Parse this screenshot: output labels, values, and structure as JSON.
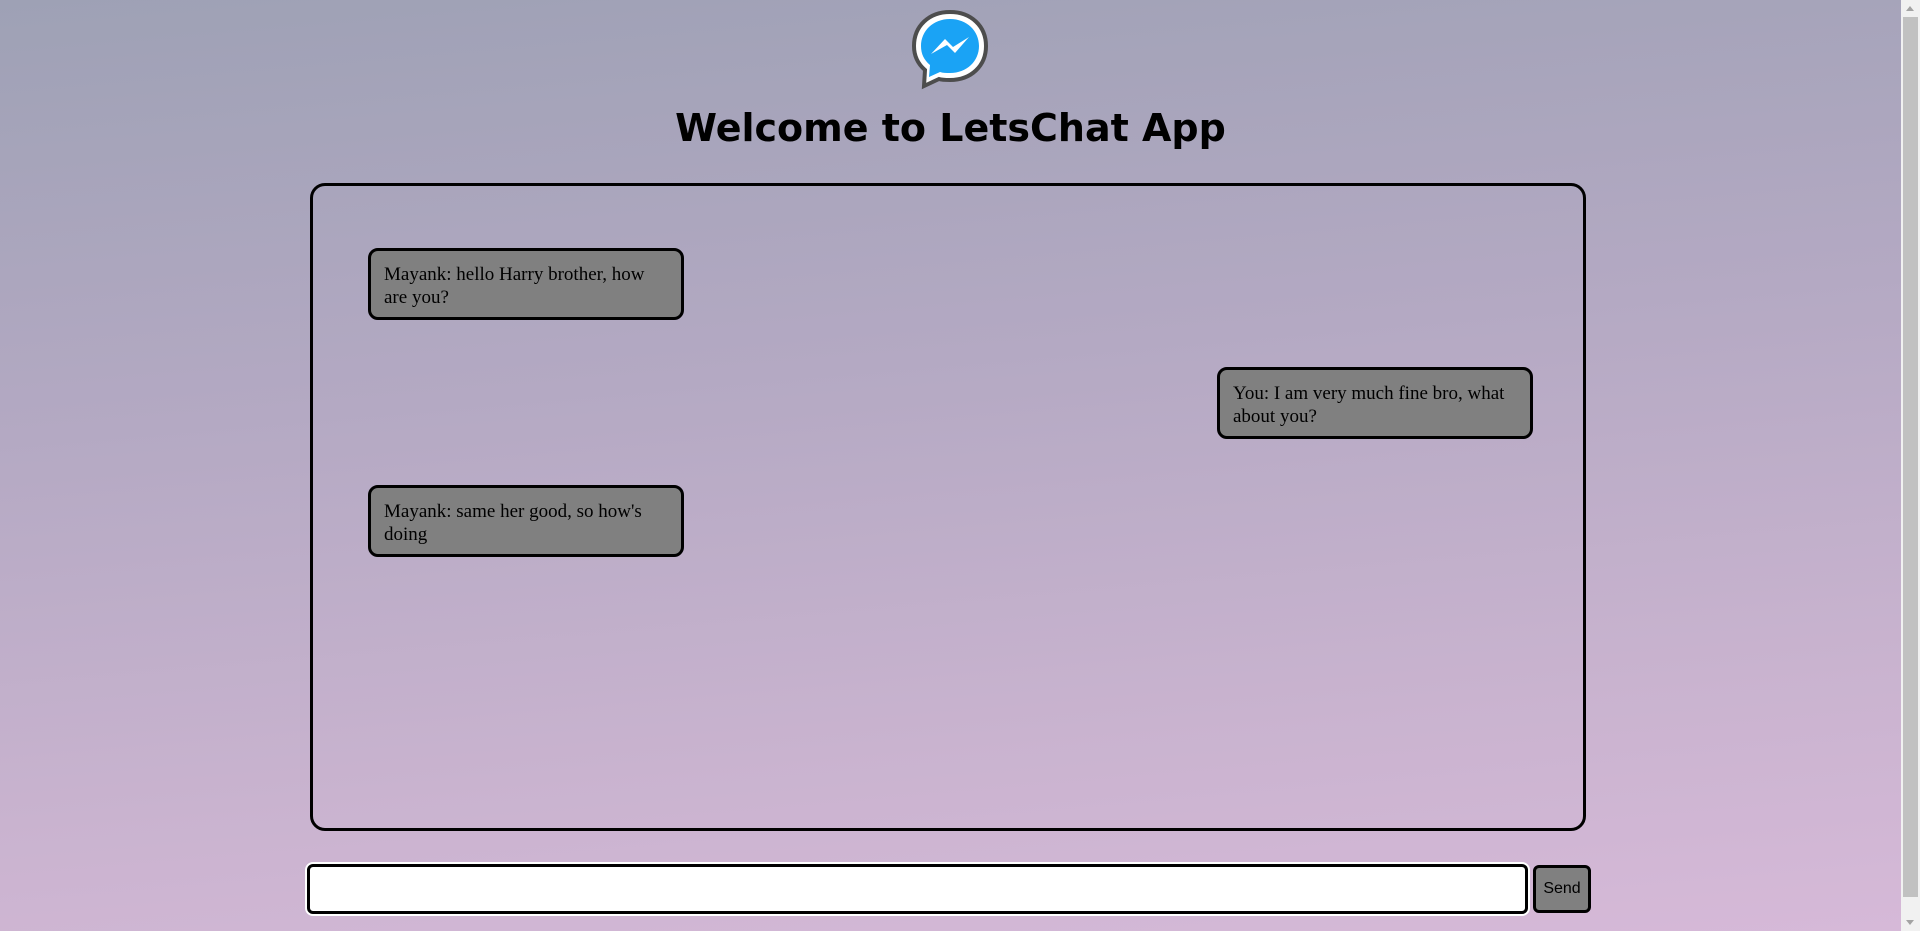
{
  "app": {
    "title": "Welcome to LetsChat App",
    "logo_icon": "messenger-icon",
    "accent_color": "#1aa3f5"
  },
  "messages": [
    {
      "side": "left",
      "text": "Mayank: hello Harry brother, how are you?"
    },
    {
      "side": "right",
      "text": "You: I am very much fine bro, what about you?"
    },
    {
      "side": "left",
      "text": "Mayank: same her good, so how's doing"
    }
  ],
  "compose": {
    "input_value": "",
    "send_label": "Send"
  }
}
